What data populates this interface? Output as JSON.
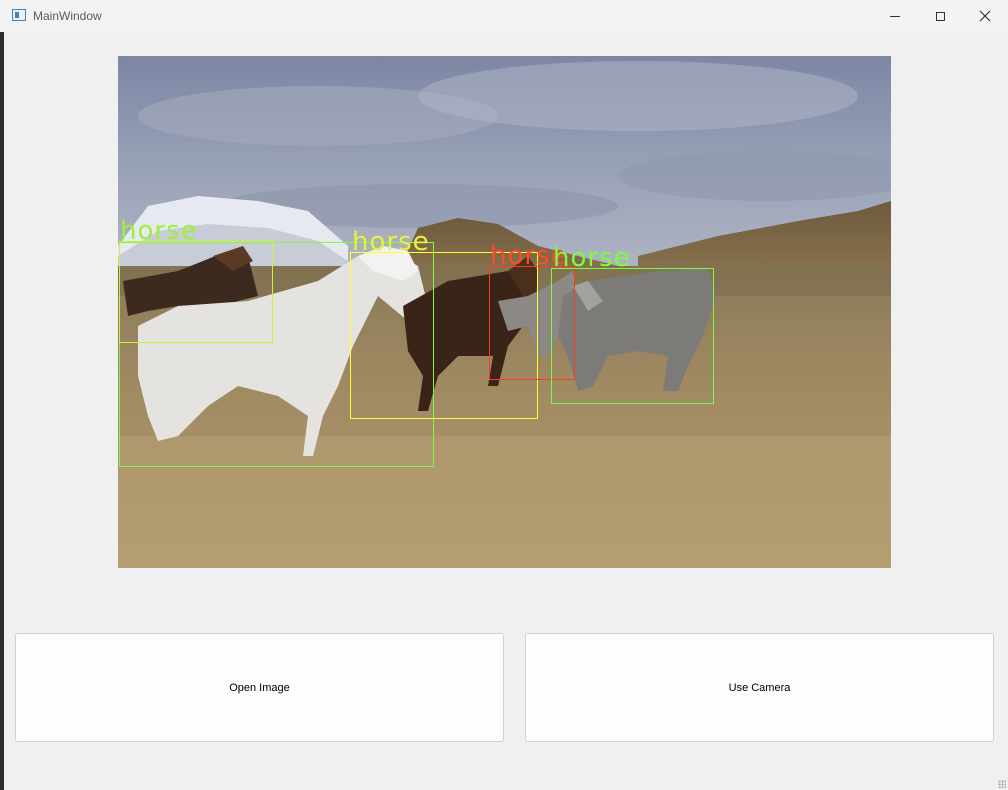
{
  "window": {
    "title": "MainWindow",
    "controls": [
      "minimize",
      "maximize",
      "close"
    ]
  },
  "image_view": {
    "scene": "horses walking on dry grassland with snowy mountain and hills under cloudy sky",
    "detections": [
      {
        "label": "horse",
        "color": "#7cfc3c"
      },
      {
        "label": "horse",
        "color": "#ffff33"
      },
      {
        "label": "horse",
        "color": "#ff3b1f"
      },
      {
        "label": "horse",
        "color": "#7cfc3c"
      }
    ]
  },
  "buttons": {
    "open_image": "Open Image",
    "use_camera": "Use Camera"
  }
}
